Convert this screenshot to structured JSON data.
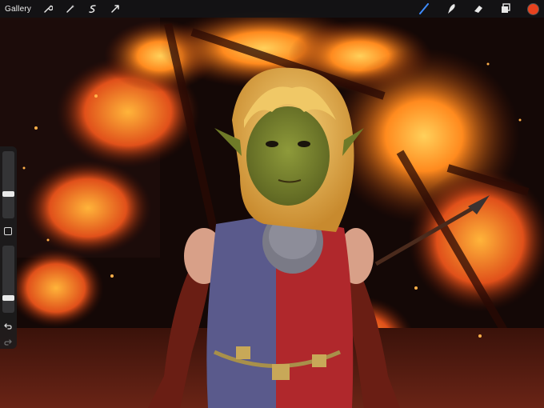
{
  "toolbar": {
    "gallery_label": "Gallery",
    "left_icons": [
      "wrench-icon",
      "magic-wand-icon",
      "selection-icon",
      "transform-arrow-icon"
    ],
    "right_icons": [
      "brush-icon",
      "smudge-icon",
      "eraser-icon",
      "layers-icon"
    ],
    "active_color": "#e8421e",
    "active_tool": "brush"
  },
  "sidebar": {
    "brush_size_level": 0.35,
    "opacity_level": 0.2,
    "controls": [
      "brush-size-slider",
      "modify-button",
      "opacity-slider",
      "undo-button",
      "redo-button"
    ]
  },
  "canvas": {
    "description_colors": {
      "fire": "#ff7a1a",
      "background": "#140806",
      "skin": "#7e8a30",
      "hair": "#e8b84a",
      "tunic_blue": "#5a5a8c",
      "tunic_red": "#b0282c"
    }
  }
}
